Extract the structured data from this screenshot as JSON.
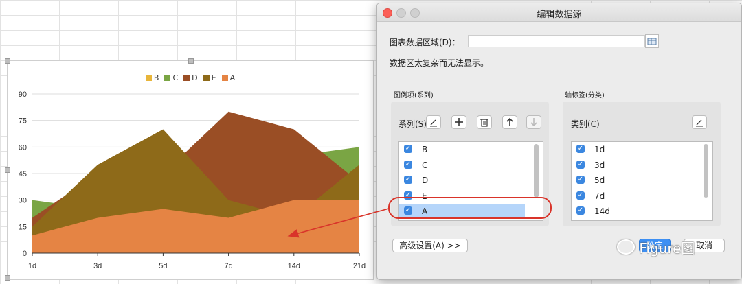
{
  "chart_data": {
    "type": "area",
    "categories": [
      "1d",
      "3d",
      "5d",
      "7d",
      "14d",
      "21d"
    ],
    "series": [
      {
        "name": "B",
        "values": [
          30,
          25,
          40,
          25,
          55,
          60
        ],
        "color": "#7aa544"
      },
      {
        "name": "C",
        "values": [
          20,
          45,
          45,
          80,
          70,
          40
        ],
        "color": "#9a4e25"
      },
      {
        "name": "D",
        "values": [
          15,
          50,
          70,
          30,
          20,
          50
        ],
        "color": "#8e6a19"
      },
      {
        "name": "A",
        "values": [
          10,
          20,
          25,
          20,
          30,
          30
        ],
        "color": "#e58444"
      }
    ],
    "legend": [
      {
        "name": "B",
        "color": "#e8b53a"
      },
      {
        "name": "C",
        "color": "#7aa544"
      },
      {
        "name": "D",
        "color": "#9a4e25"
      },
      {
        "name": "E",
        "color": "#8e6a19"
      },
      {
        "name": "A",
        "color": "#e58444"
      }
    ],
    "y_ticks": [
      "90",
      "75",
      "60",
      "45",
      "30",
      "15",
      "0"
    ],
    "ylim": [
      0,
      90
    ],
    "grid": "horizontal",
    "legend_position": "top"
  },
  "dialog": {
    "title": "编辑数据源",
    "data_range_label": "图表数据区域(D)：",
    "data_range_value": "",
    "message": "数据区太复杂而无法显示。",
    "series_group_label": "图例项(系列)",
    "series_label": "系列(S)",
    "series_items": [
      "B",
      "C",
      "D",
      "E",
      "A"
    ],
    "selected_series": "A",
    "category_group_label": "轴标签(分类)",
    "category_label": "类别(C)",
    "category_items": [
      "1d",
      "3d",
      "5d",
      "7d",
      "14d"
    ],
    "advanced_button": "高级设置(A) >>",
    "ok_button": "确定",
    "cancel_button": "取消"
  },
  "watermark": "Figure图",
  "annotation_color": "#d9342a"
}
